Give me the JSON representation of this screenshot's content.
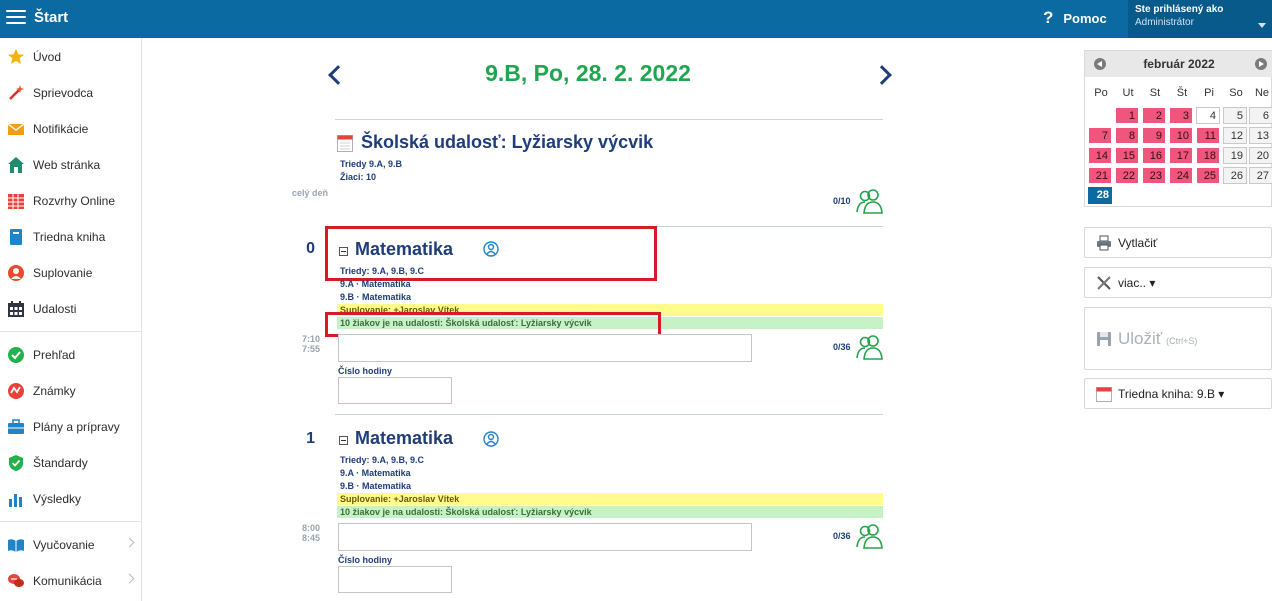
{
  "topbar": {
    "title": "Štart",
    "help_label": "Pomoc",
    "user_line1": "Ste prihlásený ako",
    "user_line2": "Administrátor"
  },
  "sidebar": {
    "items": [
      {
        "label": "Úvod",
        "icon": "star-icon"
      },
      {
        "label": "Sprievodca",
        "icon": "magic-wand-icon"
      },
      {
        "label": "Notifikácie",
        "icon": "envelope-icon"
      },
      {
        "label": "Web stránka",
        "icon": "house-icon"
      },
      {
        "label": "Rozvrhy Online",
        "icon": "timetable-icon"
      },
      {
        "label": "Triedna kniha",
        "icon": "book-icon"
      },
      {
        "label": "Suplovanie",
        "icon": "substitute-person-icon"
      },
      {
        "label": "Udalosti",
        "icon": "calendar-grid-icon"
      },
      {
        "label": "Prehľad",
        "icon": "check-circle-icon"
      },
      {
        "label": "Známky",
        "icon": "grades-icon"
      },
      {
        "label": "Plány a prípravy",
        "icon": "briefcase-icon"
      },
      {
        "label": "Štandardy",
        "icon": "shield-check-icon"
      },
      {
        "label": "Výsledky",
        "icon": "bar-chart-icon"
      },
      {
        "label": "Vyučovanie",
        "icon": "open-book-icon"
      },
      {
        "label": "Komunikácia",
        "icon": "chat-bubbles-icon"
      }
    ]
  },
  "main": {
    "date_title": "9.B, Po, 28. 2. 2022",
    "event": {
      "title": "Školská udalosť: Lyžiarsky výcvik",
      "classes": "Triedy  9.A, 9.B",
      "students": "Žiaci:  10",
      "time": "celý deň",
      "count": "0/10"
    },
    "lessons": [
      {
        "number": "0",
        "subject": "Matematika",
        "classes": "Triedy:  9.A, 9.B, 9.C",
        "group1": "9.A · Matematika",
        "group2": "9.B · Matematika",
        "substitution": "Suplovanie:   +Jaroslav Vítek",
        "absence": "10 žiakov je na udalosti: Školská udalosť: Lyžiarsky výcvik",
        "time_from": "7:10",
        "time_to": "7:55",
        "count": "0/36",
        "hour_label": "Číslo hodiny"
      },
      {
        "number": "1",
        "subject": "Matematika",
        "classes": "Triedy:  9.A, 9.B, 9.C",
        "group1": "9.A · Matematika",
        "group2": "9.B · Matematika",
        "substitution": "Suplovanie:   +Jaroslav Vítek",
        "absence": "10 žiakov je na udalosti: Školská udalosť: Lyžiarsky výcvik",
        "time_from": "8:00",
        "time_to": "8:45",
        "count": "0/36",
        "hour_label": "Číslo hodiny"
      }
    ]
  },
  "calendar": {
    "month": "február 2022",
    "weekdays": [
      "Po",
      "Ut",
      "St",
      "Št",
      "Pi",
      "So",
      "Ne"
    ],
    "weeks": [
      [
        {
          "d": "1",
          "t": "pink"
        },
        {
          "d": "2",
          "t": "pink"
        },
        {
          "d": "3",
          "t": "pink"
        },
        {
          "d": "4",
          "t": "plain"
        },
        {
          "d": "5",
          "t": "gray"
        },
        {
          "d": "6",
          "t": "gray"
        }
      ],
      [
        {
          "d": "7",
          "t": "pink"
        },
        {
          "d": "8",
          "t": "pink"
        },
        {
          "d": "9",
          "t": "pink"
        },
        {
          "d": "10",
          "t": "pink"
        },
        {
          "d": "11",
          "t": "pink"
        },
        {
          "d": "12",
          "t": "gray"
        },
        {
          "d": "13",
          "t": "gray"
        }
      ],
      [
        {
          "d": "14",
          "t": "pink"
        },
        {
          "d": "15",
          "t": "pink"
        },
        {
          "d": "16",
          "t": "pink"
        },
        {
          "d": "17",
          "t": "pink"
        },
        {
          "d": "18",
          "t": "pink"
        },
        {
          "d": "19",
          "t": "gray"
        },
        {
          "d": "20",
          "t": "gray"
        }
      ],
      [
        {
          "d": "21",
          "t": "pink"
        },
        {
          "d": "22",
          "t": "pink"
        },
        {
          "d": "23",
          "t": "pink"
        },
        {
          "d": "24",
          "t": "pink"
        },
        {
          "d": "25",
          "t": "pink"
        },
        {
          "d": "26",
          "t": "gray"
        },
        {
          "d": "27",
          "t": "gray"
        }
      ],
      [
        {
          "d": "28",
          "t": "today"
        }
      ]
    ]
  },
  "actions": {
    "print": "Vytlačiť",
    "more": "viac.. ▾",
    "save": "Uložiť",
    "save_hint": "(Ctrl+S)",
    "classbook": "Triedna kniha: 9.B ▾"
  },
  "colors": {
    "topbar": "#0a6aa1",
    "accent_green": "#1fa64f",
    "title_blue": "#1e3d7a",
    "event_pink": "#f0557d",
    "substitution_yellow": "#fffb8c",
    "absence_green": "#c6f2c6",
    "highlight_red": "#d41b26"
  }
}
